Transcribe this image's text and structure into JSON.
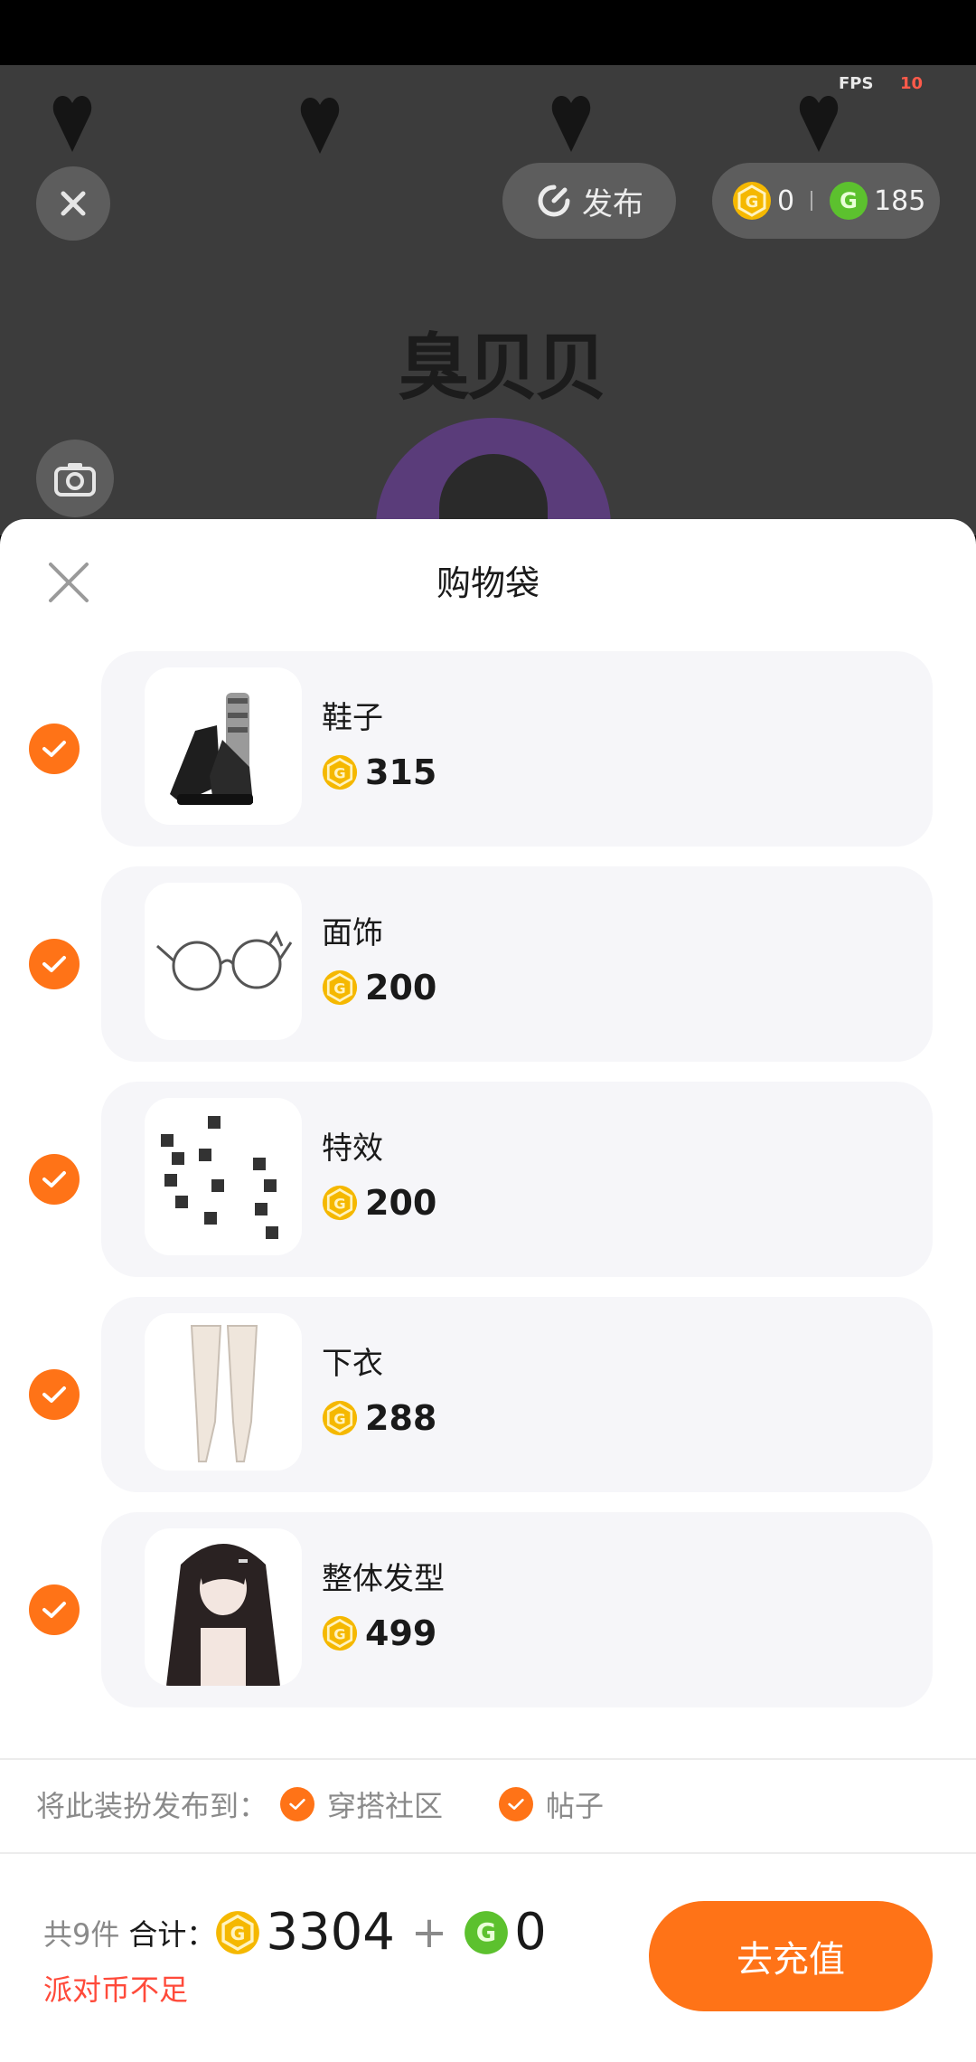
{
  "scene": {
    "fps_label": "FPS",
    "fps_value": "10",
    "publish_label": "发布",
    "gold_coin_balance": "0",
    "green_coin_balance": "185",
    "title_text": "臭贝贝"
  },
  "sheet": {
    "title": "购物袋",
    "items": [
      {
        "name": "鞋子",
        "price": "315",
        "icon": "shoes-thumbnail"
      },
      {
        "name": "面饰",
        "price": "200",
        "icon": "glasses-thumbnail"
      },
      {
        "name": "特效",
        "price": "200",
        "icon": "effect-thumbnail"
      },
      {
        "name": "下衣",
        "price": "288",
        "icon": "stockings-thumbnail"
      },
      {
        "name": "整体发型",
        "price": "499",
        "icon": "hairstyle-thumbnail"
      }
    ],
    "publish_to_label": "将此装扮发布到：",
    "publish_targets": [
      "穿搭社区",
      "帖子"
    ],
    "total_count": "共9件",
    "total_label": "合计：",
    "total_gold": "3304",
    "plus": "+",
    "total_green": "0",
    "warning": "派对币不足",
    "recharge_label": "去充值"
  },
  "colors": {
    "accent": "#ff7317",
    "warning": "#ff4a3a",
    "gold_coin": "#f5b800",
    "green_coin": "#5cc12e",
    "card_bg": "#f6f6f9"
  }
}
